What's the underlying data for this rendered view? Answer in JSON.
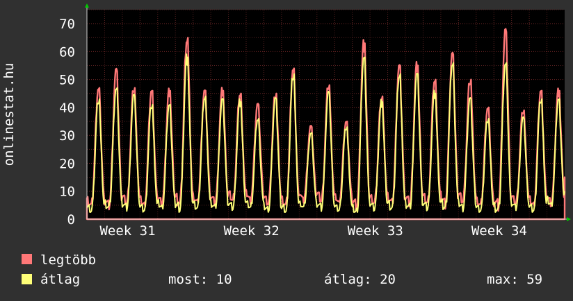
{
  "colors": {
    "background": "#303030",
    "plot_background": "#000000",
    "grid": "#5a2222",
    "axis": "#cfcfcf",
    "series_max": "#ff7878",
    "series_avg": "#ffff78",
    "axis_arrow": "#00cc00"
  },
  "chart_data": {
    "type": "area",
    "ylabel": "onlinestat.hu",
    "ylim": [
      0,
      75
    ],
    "yticks": [
      0,
      10,
      20,
      30,
      40,
      50,
      60,
      70
    ],
    "xlim": [
      0,
      27
    ],
    "xticks": [
      {
        "at": 2.3,
        "label": "Week 31"
      },
      {
        "at": 9.3,
        "label": "Week 32"
      },
      {
        "at": 16.3,
        "label": "Week 33"
      },
      {
        "at": 23.3,
        "label": "Week 34"
      }
    ],
    "x_minor_per_day": 1,
    "grid": true,
    "series": [
      {
        "name": "legtöbb",
        "color": "#ff7878",
        "style": "area",
        "daily_peaks": [
          47,
          53,
          47,
          46,
          46,
          65,
          46,
          46,
          45,
          41,
          45,
          54,
          33,
          48,
          35,
          63,
          44,
          55,
          55,
          50,
          59,
          50,
          40,
          67,
          39,
          46,
          46
        ],
        "daily_lows": [
          6,
          6,
          7,
          6,
          7,
          7,
          7,
          7,
          8,
          8,
          7,
          6,
          8,
          8,
          7,
          6,
          7,
          7,
          7,
          7,
          7,
          8,
          6,
          6,
          7,
          6,
          7
        ]
      },
      {
        "name": "átlag",
        "color": "#ffff78",
        "style": "line",
        "daily_peaks": [
          43,
          47,
          44,
          41,
          41,
          58,
          44,
          43,
          42,
          36,
          43,
          52,
          31,
          45,
          33,
          58,
          42,
          52,
          52,
          45,
          56,
          43,
          36,
          56,
          36,
          43,
          43
        ],
        "daily_lows": [
          4,
          5,
          5,
          4,
          5,
          5,
          5,
          5,
          5,
          5,
          4,
          4,
          5,
          5,
          4,
          3,
          5,
          5,
          5,
          5,
          5,
          5,
          4,
          4,
          5,
          4,
          6
        ]
      }
    ],
    "last_value": 15,
    "last_avg": 10
  },
  "legend": {
    "max_label": "legtöbb",
    "avg_label": "átlag",
    "now_text": "most: 10",
    "avg_text": "átlag: 20",
    "max_text": "max: 59"
  }
}
